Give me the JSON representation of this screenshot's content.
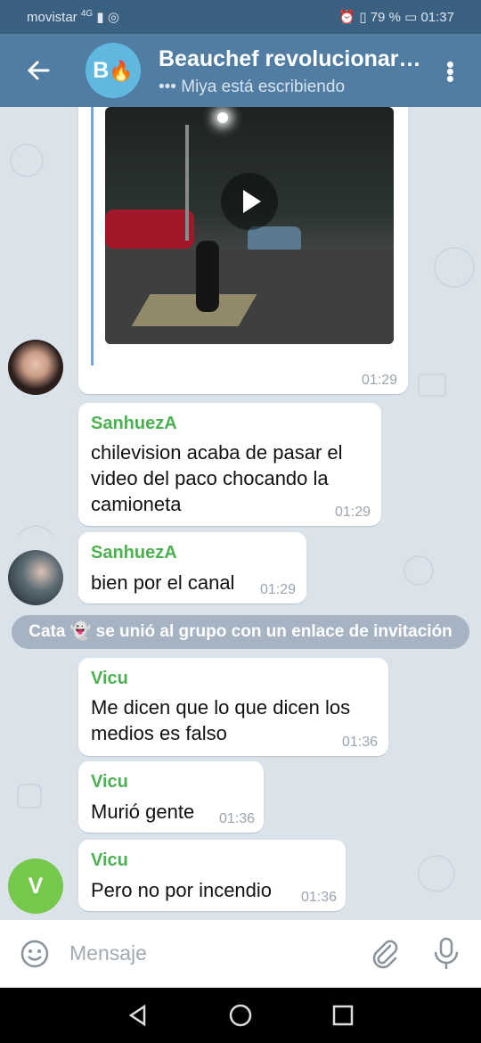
{
  "status": {
    "carrier": "movistar",
    "network": "4G",
    "battery": "79 %",
    "time": "01:37"
  },
  "header": {
    "title": "Beauchef revolucionar…",
    "subtitle": "Miya está escribiendo",
    "avatar_letter": "B"
  },
  "messages": [
    {
      "id": "video",
      "time": "01:29"
    },
    {
      "id": "m1",
      "sender": "SanhuezA",
      "lines": [
        "chilevision acaba de pasar el",
        "video del paco chocando la",
        "camioneta"
      ],
      "time": "01:29"
    },
    {
      "id": "m2",
      "sender": "SanhuezA",
      "lines": [
        "bien por el canal"
      ],
      "time": "01:29"
    },
    {
      "id": "m3",
      "sender": "Vicu",
      "lines": [
        "Me dicen que lo que dicen los",
        "medios es falso"
      ],
      "time": "01:36"
    },
    {
      "id": "m4",
      "sender": "Vicu",
      "lines": [
        "Murió gente"
      ],
      "time": "01:36"
    },
    {
      "id": "m5",
      "sender": "Vicu",
      "lines": [
        "Pero no por incendio"
      ],
      "time": "01:36"
    }
  ],
  "service_message": "Cata 👻 se unió al grupo con un enlace de invitación",
  "avatar_v_letter": "V",
  "input": {
    "placeholder": "Mensaje"
  },
  "icons": {
    "back": "arrow-left-icon",
    "menu": "more-vert-icon",
    "emoji": "emoji-icon",
    "attach": "paperclip-icon",
    "mic": "mic-icon",
    "play": "play-icon"
  },
  "colors": {
    "header": "#517da2",
    "status": "#3a6182",
    "sender": "#4db051",
    "chat_bg": "#dbe3ea"
  }
}
